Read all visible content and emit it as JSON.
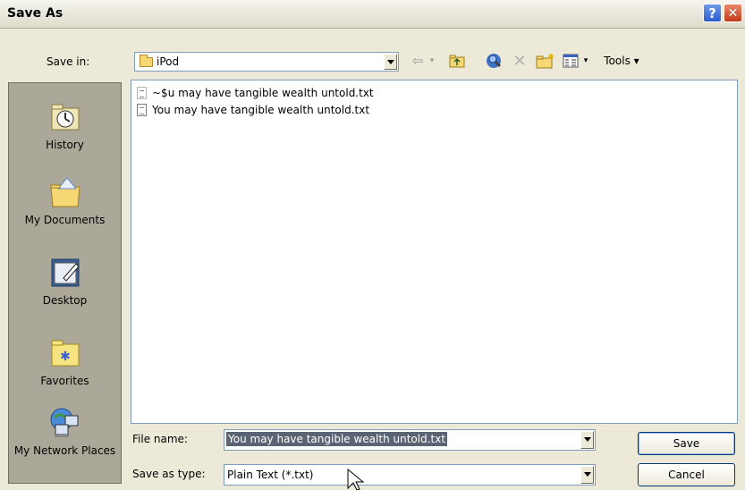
{
  "window": {
    "title": "Save As"
  },
  "toolbar": {
    "save_in_label": "Save in:",
    "save_in_value": "iPod",
    "tools_label": "Tools ▾"
  },
  "places": [
    {
      "label": "History"
    },
    {
      "label": "My Documents"
    },
    {
      "label": "Desktop"
    },
    {
      "label": "Favorites"
    },
    {
      "label": "My Network Places"
    }
  ],
  "files": [
    {
      "name": "~$u may have tangible wealth untold.txt"
    },
    {
      "name": "You may have tangible wealth untold.txt"
    }
  ],
  "file_name": {
    "label": "File name:",
    "value": "You may have tangible wealth untold.txt"
  },
  "save_as_type": {
    "label": "Save as type:",
    "value": "Plain Text (*.txt)"
  },
  "buttons": {
    "save": "Save",
    "cancel": "Cancel"
  },
  "colors": {
    "accent": "#316ac5",
    "selection": "#5a6473"
  }
}
